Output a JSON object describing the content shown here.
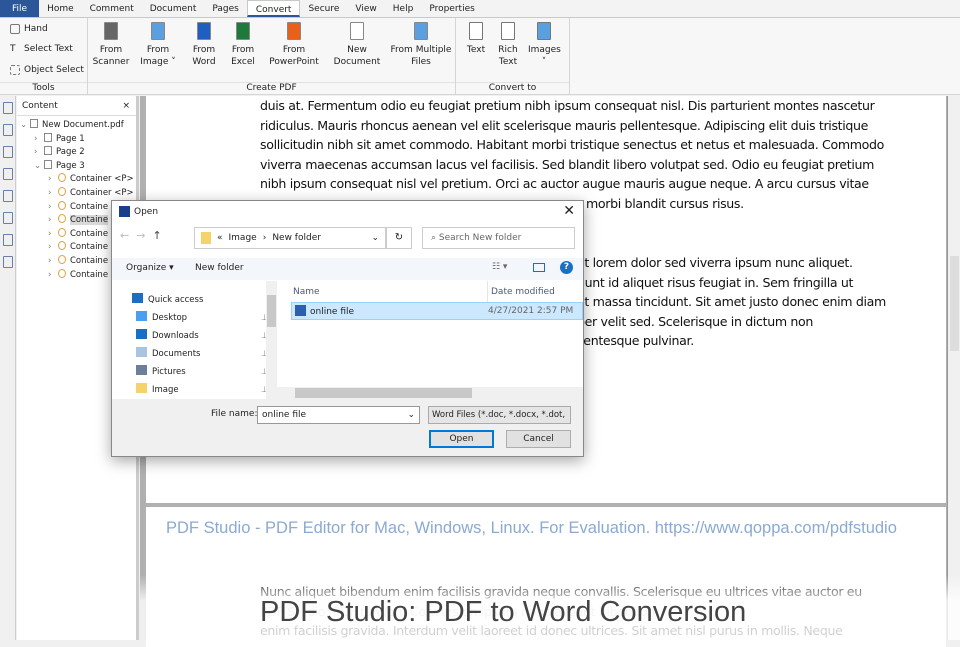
{
  "menu": {
    "tabs": [
      "File",
      "Home",
      "Comment",
      "Document",
      "Pages",
      "Convert",
      "Secure",
      "View",
      "Help",
      "Properties"
    ],
    "active": "Convert"
  },
  "ribbon": {
    "tools": {
      "label": "Tools",
      "items": [
        "Hand",
        "Select Text",
        "Object Select"
      ]
    },
    "create_pdf": {
      "label": "Create PDF",
      "buttons": [
        [
          "From",
          "Scanner"
        ],
        [
          "From",
          "Image ˅"
        ],
        [
          "From",
          "Word"
        ],
        [
          "From",
          "Excel"
        ],
        [
          "From",
          "PowerPoint"
        ],
        [
          "New",
          "Document"
        ],
        [
          "From Multiple",
          "Files"
        ]
      ]
    },
    "convert_to": {
      "label": "Convert to",
      "buttons": [
        [
          "Text",
          ""
        ],
        [
          "Rich",
          "Text"
        ],
        [
          "Images",
          "˅"
        ]
      ]
    }
  },
  "content_panel": {
    "title": "Content",
    "close": "×",
    "root": "New Document.pdf",
    "pages": [
      "Page 1",
      "Page 2",
      "Page 3"
    ],
    "containers": [
      "Container <P>",
      "Container <P>",
      "Containe",
      "Containe",
      "Containe",
      "Containe",
      "Containe",
      "Containe"
    ]
  },
  "document": {
    "para1": [
      "duis at. Fermentum odio eu feugiat pretium nibh ipsum consequat nisl. Dis parturient montes nascetur",
      "ridiculus. Mauris rhoncus aenean vel elit scelerisque mauris pellentesque. Adipiscing elit duis tristique",
      "sollicitudin nibh sit amet commodo. Habitant morbi tristique senectus et netus et malesuada. Commodo",
      "viverra maecenas accumsan lacus vel facilisis. Sed blandit libero volutpat sed. Odio eu feugiat pretium",
      "nibh ipsum consequat nisl vel pretium. Orci ac auctor augue mauris augue neque. A arcu cursus vitae",
      "morbi blandit cursus risus."
    ],
    "para2": [
      "et lorem dolor sed viverra ipsum nunc aliquet.",
      "dunt id aliquet risus feugiat in. Sem fringilla ut",
      "et massa tincidunt. Sit amet justo donec enim diam",
      "per velit sed. Scelerisque in dictum non",
      "llentesque pulvinar."
    ],
    "watermark": "PDF Studio - PDF Editor for Mac, Windows, Linux. For Evaluation. https://www.qoppa.com/pdfstudio",
    "para3": [
      "Nunc aliquet bibendum enim facilisis gravida neque convallis. Scelerisque eu ultrices vitae auctor eu",
      "PDF Studio: PDF to Word Conversion ipsum nunc aliquet bibendum",
      "enim facilisis gravida. Interdum velit laoreet id donec ultrices. Sit amet nisl purus in mollis. Neque"
    ]
  },
  "caption": "PDF Studio: PDF to Word Conversion",
  "dialog": {
    "title": "Open",
    "close": "✕",
    "path": [
      "«",
      "Image",
      "›",
      "New folder"
    ],
    "search_placeholder": "Search New folder",
    "organize": "Organize ▾",
    "new_folder": "New folder",
    "nav": [
      "Quick access",
      "Desktop",
      "Downloads",
      "Documents",
      "Pictures",
      "Image"
    ],
    "columns": {
      "name": "Name",
      "date": "Date modified"
    },
    "files": [
      {
        "name": "online file",
        "date": "4/27/2021 2:57 PM"
      }
    ],
    "file_name_label": "File name:",
    "file_name": "online file",
    "file_type": "Word Files (*.doc, *.docx, *.dot,",
    "open": "Open",
    "cancel": "Cancel"
  }
}
